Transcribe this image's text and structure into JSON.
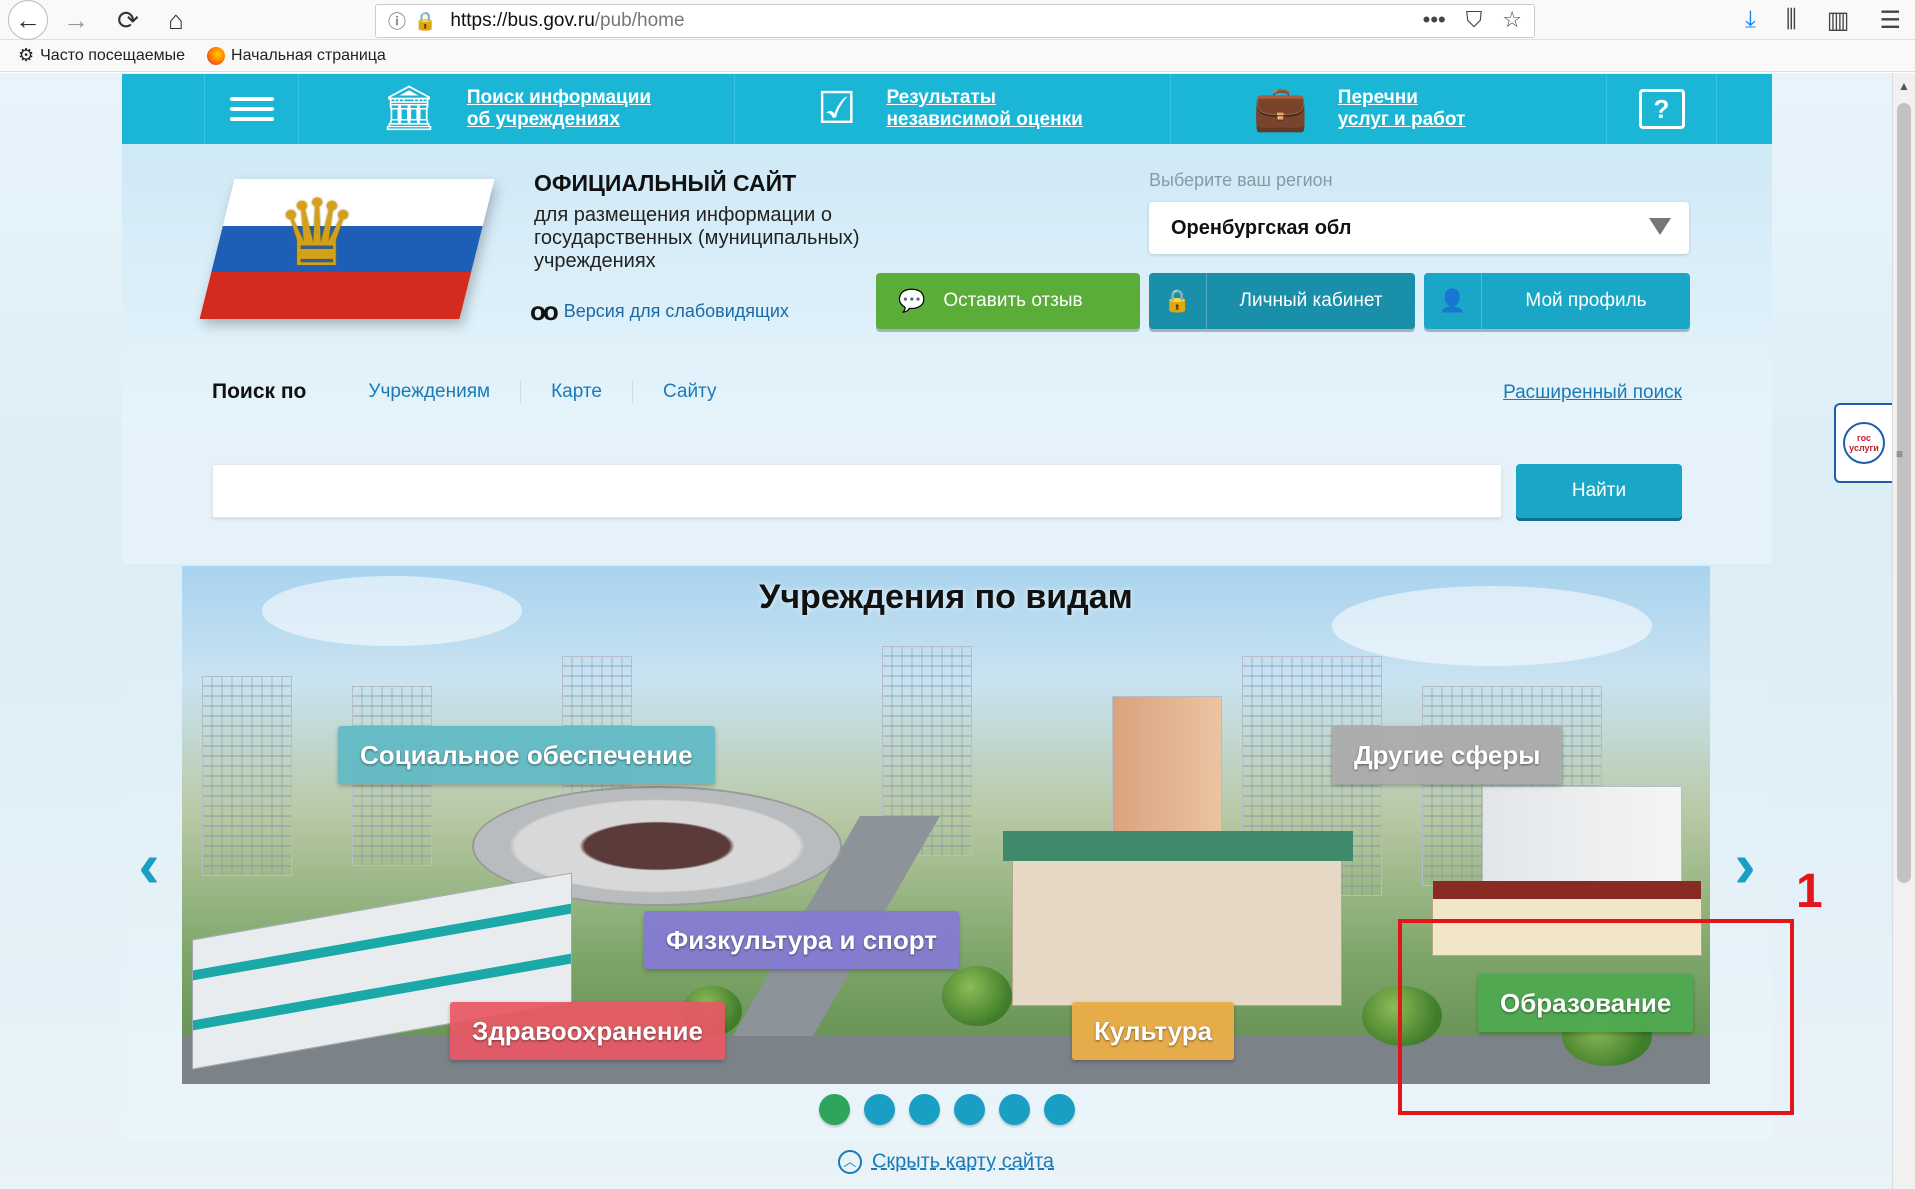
{
  "browser": {
    "url_host": "https://bus.gov.ru",
    "url_path": "/pub/home",
    "bookmarks": [
      "Часто посещаемые",
      "Начальная страница"
    ]
  },
  "nav": {
    "items": [
      {
        "label": "Поиск информации\nоб учреждениях",
        "icon": "institution-icon"
      },
      {
        "label": "Результаты\nнезависимой оценки",
        "icon": "checkmark-clipboard-icon"
      },
      {
        "label": "Перечни\nуслуг и работ",
        "icon": "briefcase-icon"
      }
    ],
    "help_label": "?"
  },
  "header": {
    "title": "ОФИЦИАЛЬНЫЙ САЙТ",
    "subtitle": "для размещения информации о государственных (муниципальных) учреждениях",
    "low_vision": "Версия для слабовидящих",
    "region_label": "Выберите ваш регион",
    "region_value": "Оренбургская обл",
    "feedback_button": "Оставить отзыв",
    "cabinet_button": "Личный кабинет",
    "profile_button": "Мой профиль"
  },
  "search": {
    "label": "Поиск по",
    "tabs": [
      "Учреждениям",
      "Карте",
      "Сайту"
    ],
    "advanced": "Расширенный поиск",
    "placeholder": "",
    "button": "Найти"
  },
  "carousel": {
    "title": "Учреждения по видам",
    "categories": {
      "social": "Социальное обеспечение",
      "other": "Другие сферы",
      "sport": "Физкультура и спорт",
      "health": "Здравоохранение",
      "culture": "Культура",
      "education": "Образование"
    },
    "slide_count": 6,
    "active_slide": 1
  },
  "footer": {
    "hide_map": "Скрыть карту сайта"
  },
  "widget": {
    "gosuslugi": "гос услуги"
  },
  "annotation": {
    "number": "1",
    "color": "#e3151a"
  },
  "colors": {
    "nav_bg": "#1bb5d6",
    "feedback_btn": "#59ad38",
    "cabinet_btn": "#1a8fa9",
    "profile_btn": "#1aa7c7",
    "active_dot": "#2ea45c"
  }
}
